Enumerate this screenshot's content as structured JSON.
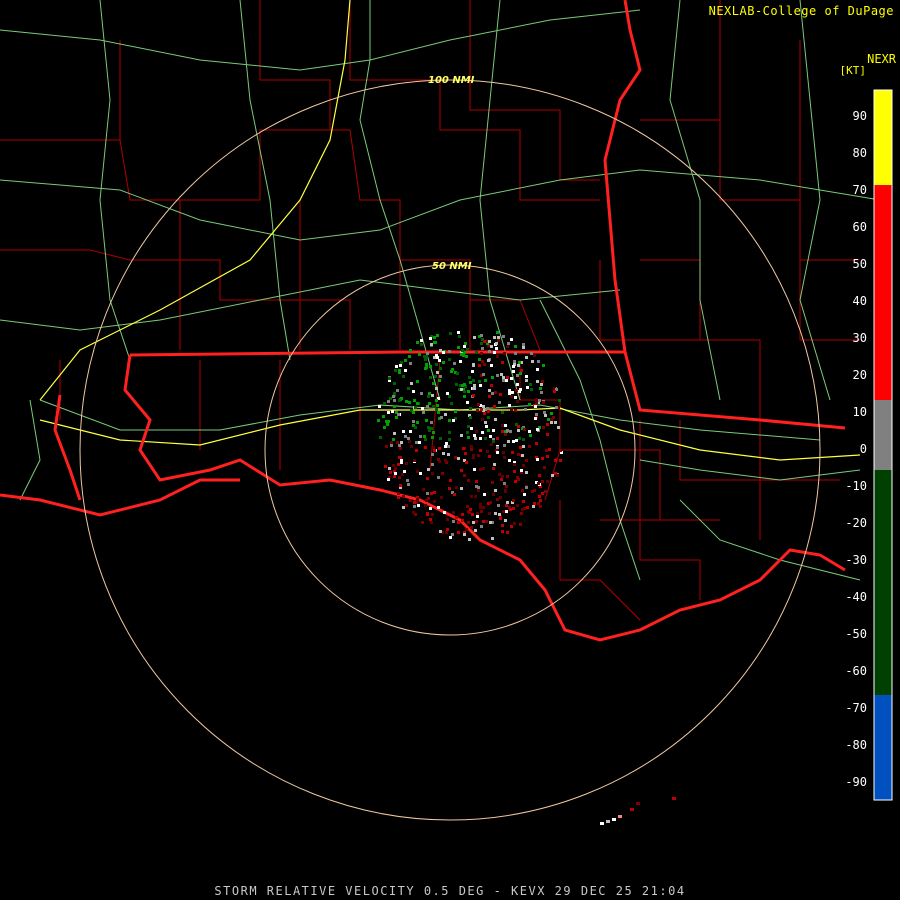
{
  "header": {
    "credit": "NEXLAB-College of DuPage",
    "product": "NEXR",
    "units": "[KT]"
  },
  "footer": {
    "caption": "STORM RELATIVE VELOCITY 0.5 DEG - KEVX 29 DEC 25 21:04"
  },
  "range_rings": [
    {
      "label": "100 NMI"
    },
    {
      "label": "50 NMI"
    }
  ],
  "legend": {
    "ticks": [
      "90",
      "80",
      "70",
      "60",
      "50",
      "40",
      "30",
      "20",
      "10",
      "0",
      "-10",
      "-20",
      "-30",
      "-40",
      "-50",
      "-60",
      "-70",
      "-80",
      "-90"
    ],
    "colors": {
      "top": "#ffff00",
      "orange": "#f0a060",
      "red": "#ff0000",
      "dark_red": "#600000",
      "gray": "#808080",
      "white": "#ffffff",
      "dark_green": "#004000",
      "green": "#00ff40",
      "blue": "#0050c0",
      "light_blue": "#00a0ff"
    }
  },
  "map_colors": {
    "state_border": "#ff2020",
    "county_line": "#b00000",
    "highway": "#90ee90",
    "interstate": "#ffff40",
    "ring": "#f0c8a0"
  }
}
